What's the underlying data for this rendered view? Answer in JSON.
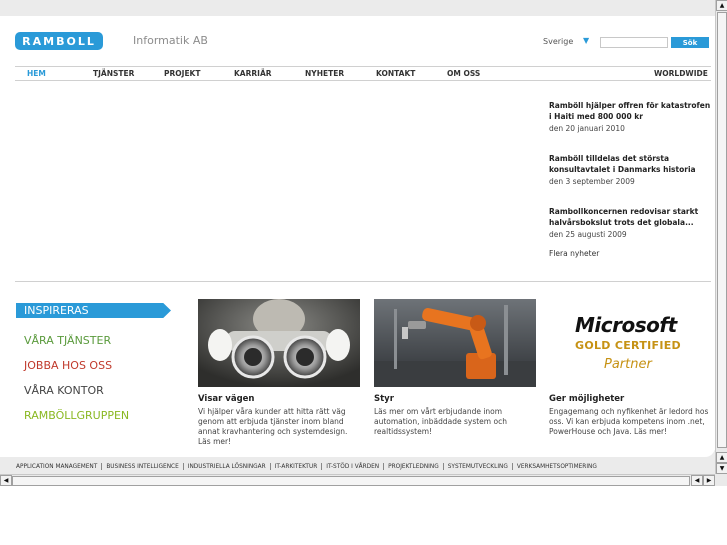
{
  "header": {
    "logo_text": "RAMBOLL",
    "company": "Informatik AB",
    "country": "Sverige",
    "search_button": "Sök"
  },
  "nav": {
    "items": [
      "HEM",
      "TJÄNSTER",
      "PROJEKT",
      "KARRIÄR",
      "NYHETER",
      "KONTAKT",
      "OM OSS",
      "WORLDWIDE"
    ]
  },
  "news": {
    "items": [
      {
        "title": "Ramböll hjälper offren för katastrofen i Haiti med 800 000 kr",
        "date": "den 20 januari 2010"
      },
      {
        "title": "Ramböll tilldelas det största konsultavtalet i Danmarks historia",
        "date": "den 3 september 2009"
      },
      {
        "title": "Rambollkoncernen redovisar starkt halvårsbokslut trots det globala...",
        "date": "den 25 augusti 2009"
      }
    ],
    "more": "Flera nyheter"
  },
  "left_menu": {
    "items": [
      "INSPIRERAS",
      "VÅRA TJÄNSTER",
      "JOBBA HOS OSS",
      "VÅRA KONTOR",
      "RAMBÖLLGRUPPEN"
    ],
    "colors": [
      "#ffffff",
      "#5a9a3c",
      "#c0392b",
      "#444444",
      "#8ab822"
    ]
  },
  "features": [
    {
      "title": "Visar vägen",
      "text": "Vi hjälper våra kunder att hitta rätt väg genom att erbjuda tjänster inom bland annat kravhantering och systemdesign. Läs mer!"
    },
    {
      "title": "Styr",
      "text": "Läs mer om vårt erbjudande inom automation, inbäddade system och realtidssystem!"
    },
    {
      "title": "Ger möjligheter",
      "text": "Engagemang och nyfikenhet är ledord hos oss. Vi kan erbjuda kompetens inom .net, PowerHouse och Java. Läs mer!"
    }
  ],
  "ms_logo": {
    "word": "Microsoft",
    "gold": "GOLD CERTIFIED",
    "partner": "Partner"
  },
  "footer": {
    "links": [
      "APPLICATION MANAGEMENT",
      "BUSINESS INTELLIGENCE",
      "INDUSTRIELLA LÖSNINGAR",
      "IT-ARKITEKTUR",
      "IT-STÖD I VÅRDEN",
      "PROJEKTLEDNING",
      "SYSTEMUTVECKLING",
      "VERKSAMHETSOPTIMERING"
    ]
  },
  "colors": {
    "accent": "#2a9ad8",
    "background": "#ebebeb",
    "gold": "#c69214"
  }
}
